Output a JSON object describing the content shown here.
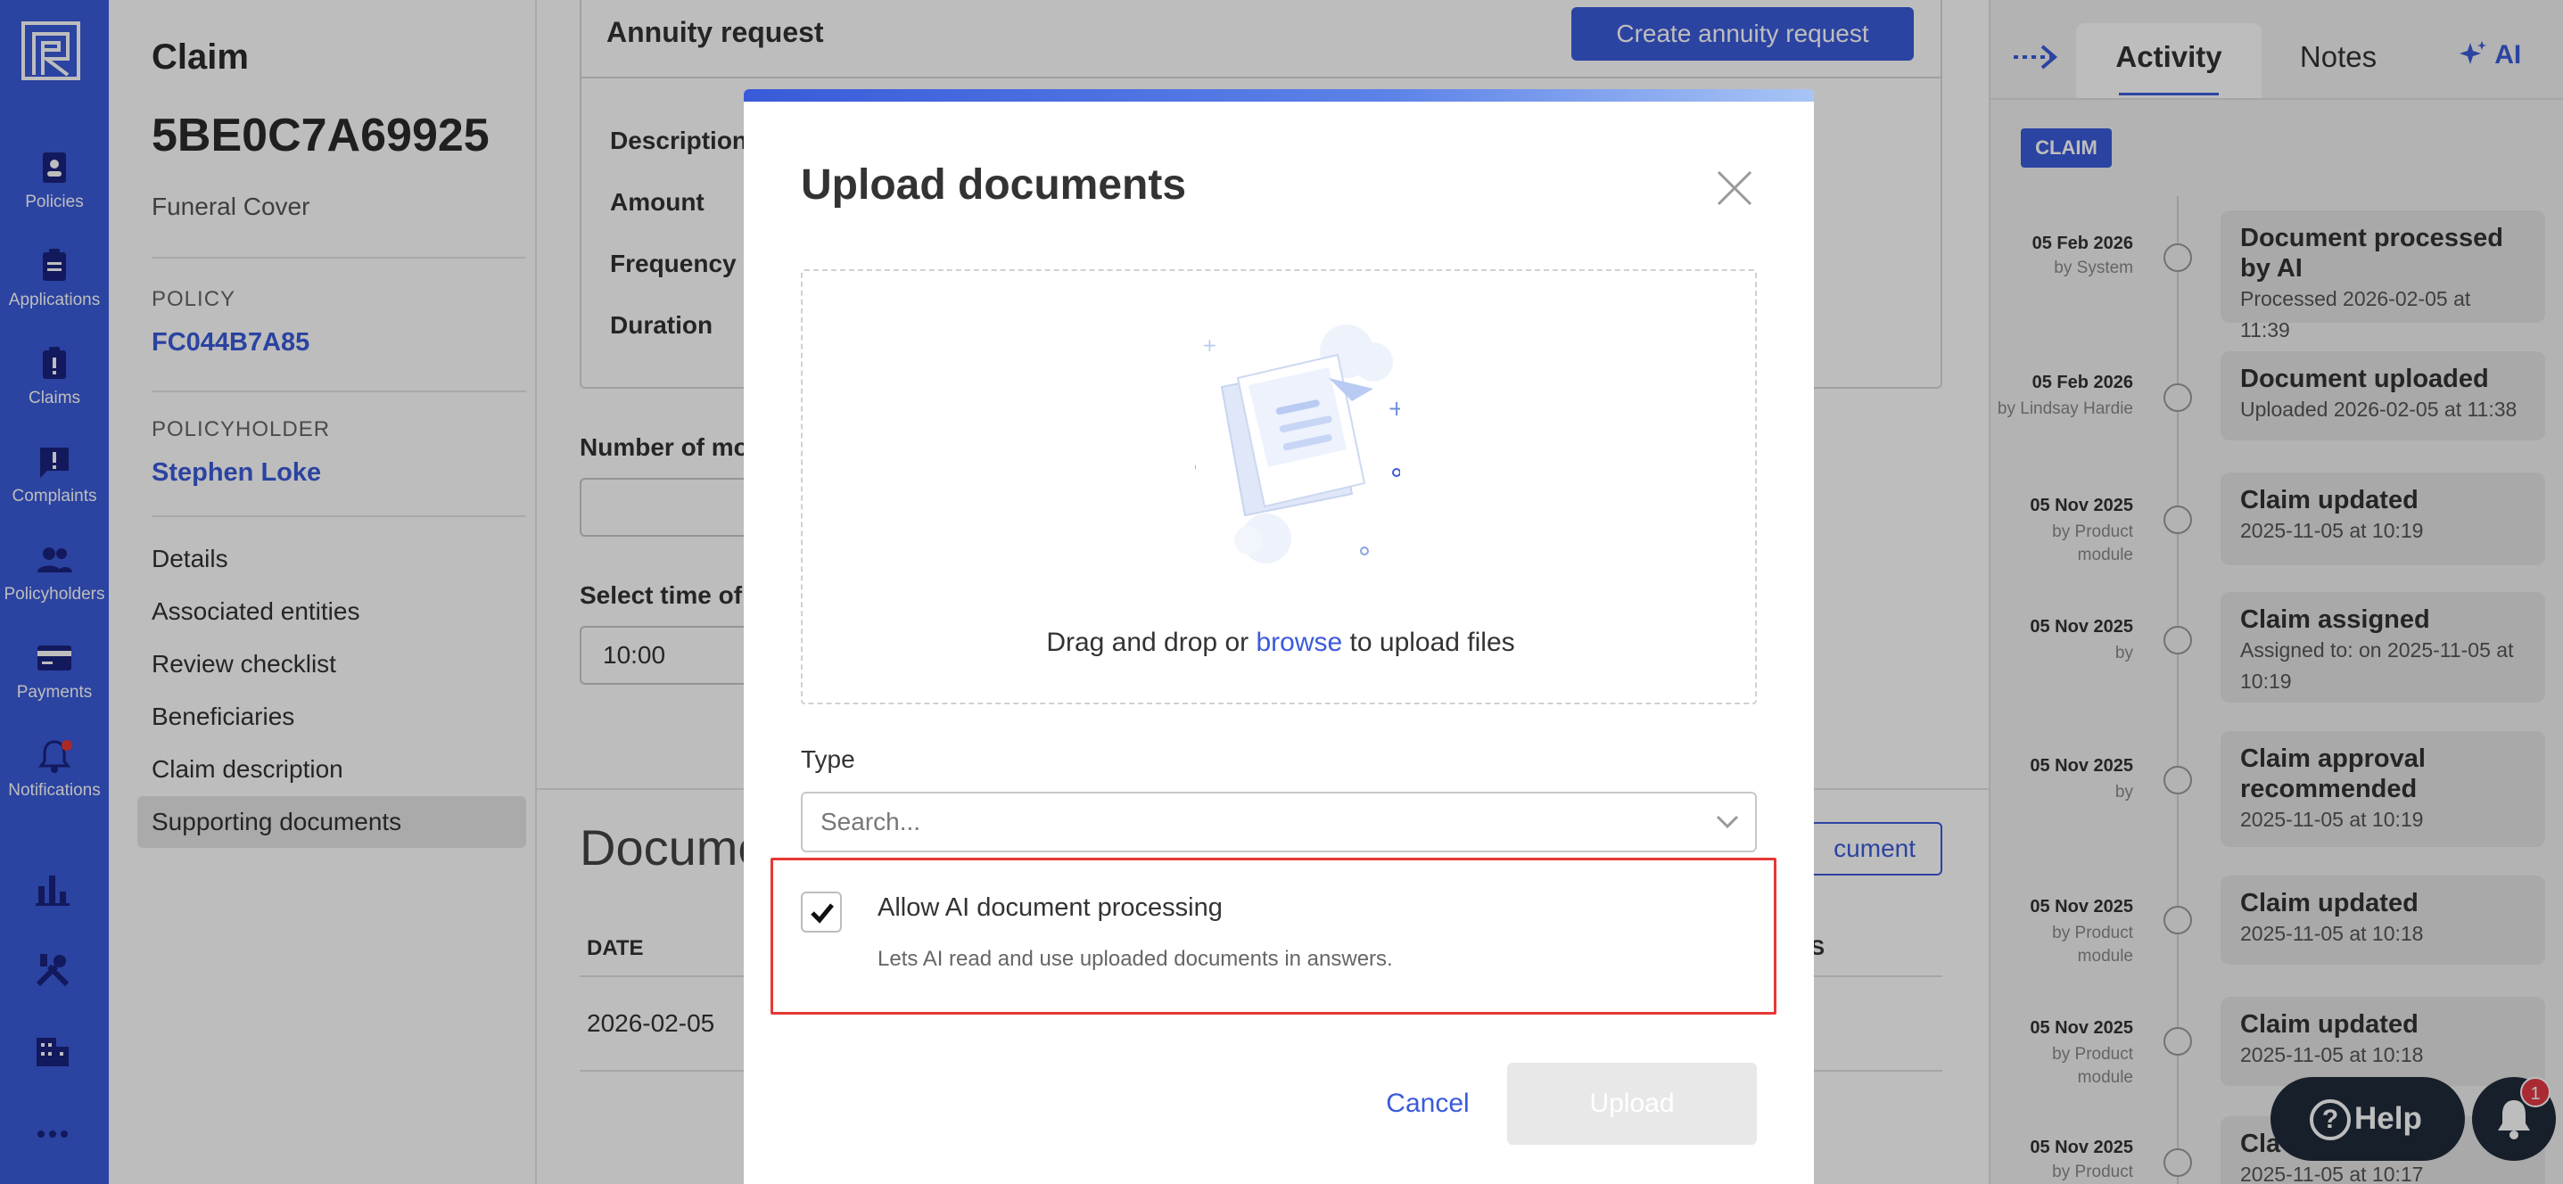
{
  "nav": {
    "items": [
      {
        "label": "Policies",
        "icon": "policies-icon"
      },
      {
        "label": "Applications",
        "icon": "applications-icon"
      },
      {
        "label": "Claims",
        "icon": "claims-icon"
      },
      {
        "label": "Complaints",
        "icon": "complaints-icon"
      },
      {
        "label": "Policyholders",
        "icon": "policyholders-icon"
      },
      {
        "label": "Payments",
        "icon": "payments-icon"
      },
      {
        "label": "Notifications",
        "icon": "notifications-icon"
      }
    ],
    "extra_icons": [
      "bar-chart-icon",
      "tools-icon",
      "building-icon",
      "more-icon"
    ],
    "accent_color": "#3a5bd9"
  },
  "claim": {
    "label": "Claim",
    "id": "5BE0C7A69925",
    "product": "Funeral Cover",
    "policy_title": "POLICY",
    "policy_number": "FC044B7A85",
    "policyholder_title": "POLICYHOLDER",
    "policyholder_name": "Stephen Loke",
    "menu": [
      "Details",
      "Associated entities",
      "Review checklist",
      "Beneficiaries",
      "Claim description",
      "Supporting documents"
    ],
    "active_menu": "Supporting documents"
  },
  "main": {
    "annuity_title": "Annuity request",
    "create_button": "Create annuity request",
    "fields": [
      "Description",
      "Amount",
      "Frequency",
      "Duration"
    ],
    "number_label": "Number of mo",
    "time_label": "Select time of i",
    "time_value": "10:00",
    "documents_title": "Docume",
    "add_document_button": "cument",
    "table_headers": {
      "date": "DATE",
      "status": "S"
    },
    "rows": [
      {
        "date": "2026-02-05"
      }
    ]
  },
  "activity": {
    "tabs": {
      "activity": "Activity",
      "notes": "Notes",
      "ai": "AI"
    },
    "badge": "CLAIM",
    "events": [
      {
        "date": "05 Feb 2026",
        "by": "by System",
        "title": "Document processed by AI",
        "sub": "Processed 2026-02-05 at 11:39"
      },
      {
        "date": "05 Feb 2026",
        "by": "by Lindsay Hardie",
        "title": "Document uploaded",
        "sub": "Uploaded 2026-02-05 at 11:38"
      },
      {
        "date": "05 Nov 2025",
        "by": "by Product module",
        "title": "Claim updated",
        "sub": "2025-11-05 at 10:19"
      },
      {
        "date": "05 Nov 2025",
        "by": "by",
        "title": "Claim assigned",
        "sub": "Assigned to: on 2025-11-05 at 10:19"
      },
      {
        "date": "05 Nov 2025",
        "by": "by",
        "title": "Claim approval recommended",
        "sub": "2025-11-05 at 10:19"
      },
      {
        "date": "05 Nov 2025",
        "by": "by Product module",
        "title": "Claim updated",
        "sub": "2025-11-05 at 10:18"
      },
      {
        "date": "05 Nov 2025",
        "by": "by Product module",
        "title": "Claim updated",
        "sub": "2025-11-05 at 10:18"
      },
      {
        "date": "05 Nov 2025",
        "by": "by Product",
        "title": "Cla",
        "sub": "2025-11-05 at 10:17"
      }
    ],
    "help_label": "Help",
    "notifications_count": "1"
  },
  "modal": {
    "title": "Upload documents",
    "dropzone_text_before": "Drag and drop or",
    "dropzone_browse": "browse",
    "dropzone_text_after": "to upload files",
    "type_label": "Type",
    "type_placeholder": "Search...",
    "ai_checkbox_label": "Allow AI document processing",
    "ai_checkbox_sub": "Lets AI read and use uploaded documents in answers.",
    "ai_checkbox_checked": true,
    "highlight_color": "#e53935",
    "cancel_button": "Cancel",
    "upload_button": "Upload"
  }
}
